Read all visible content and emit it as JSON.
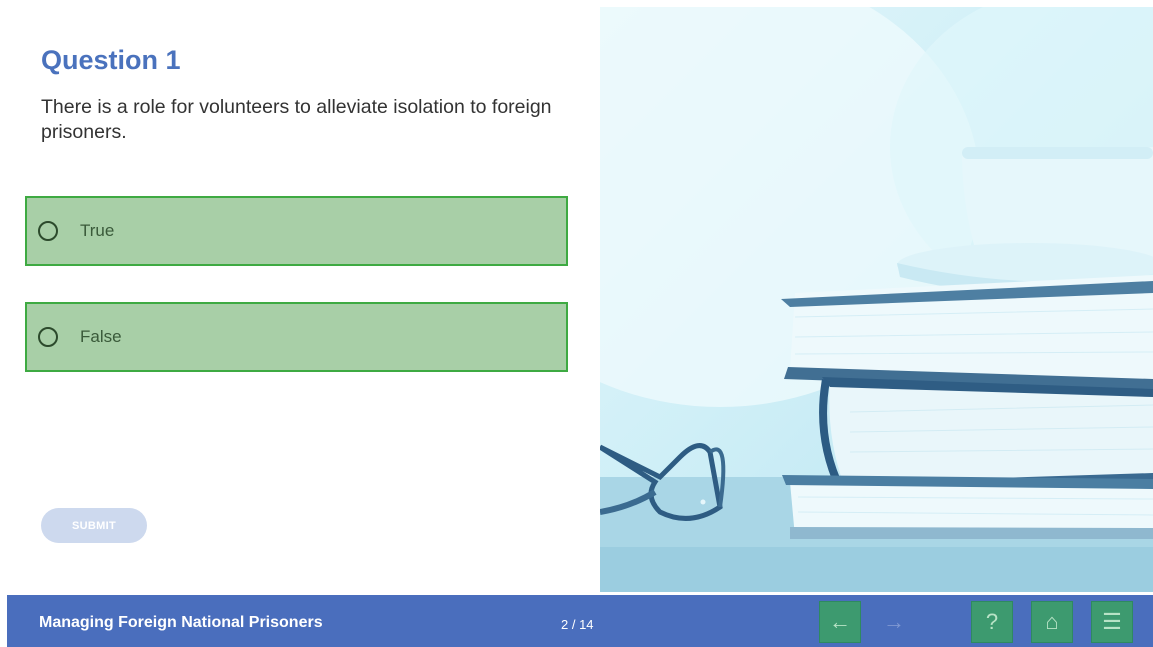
{
  "quiz": {
    "title": "Question 1",
    "question": "There is a role for volunteers to alleviate isolation to foreign prisoners.",
    "options": [
      {
        "label": "True"
      },
      {
        "label": "False"
      }
    ],
    "submit_label": "SUBMIT"
  },
  "footer": {
    "course_title": "Managing Foreign National Prisoners",
    "page_indicator": "2 / 14",
    "icons": [
      "arrow-left-icon",
      "arrow-right-icon",
      "help-icon",
      "home-icon",
      "menu-icon"
    ]
  },
  "colors": {
    "title": "#4a72bd",
    "option_fill": "#a8cfa7",
    "option_border": "#3eaa42",
    "footer_bg": "#4a6ebd",
    "nav_button": "#3d9a6f"
  }
}
